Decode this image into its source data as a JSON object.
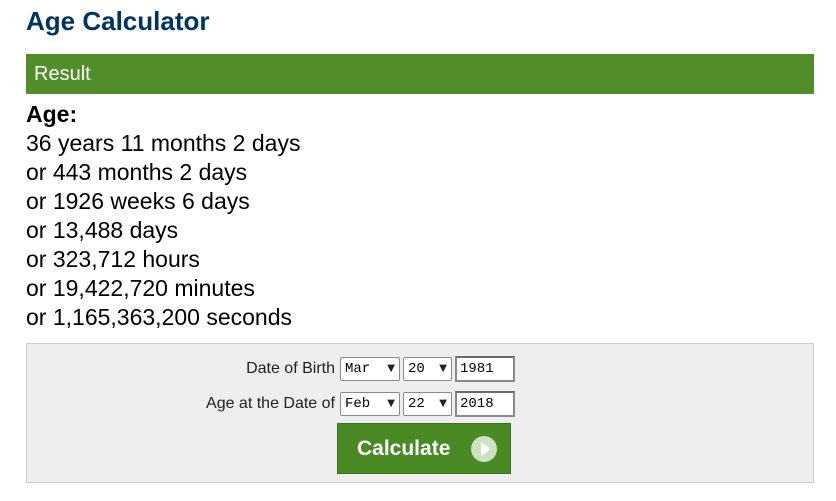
{
  "page": {
    "title": "Age Calculator"
  },
  "result": {
    "header": "Result",
    "age_label": "Age:",
    "lines": [
      "36 years 11 months 2 days",
      "or 443 months 2 days",
      "or 1926 weeks 6 days",
      "or 13,488 days",
      "or 323,712 hours",
      "or 19,422,720 minutes",
      "or 1,165,363,200 seconds"
    ]
  },
  "form": {
    "dob": {
      "label": "Date of Birth",
      "month": "Mar",
      "day": "20",
      "year": "1981"
    },
    "age_at": {
      "label": "Age at the Date of",
      "month": "Feb",
      "day": "22",
      "year": "2018"
    },
    "calculate_label": "Calculate"
  },
  "colors": {
    "title": "#003366",
    "result_bar": "#518e2a",
    "button": "#4a8a24"
  },
  "icons": {
    "select_arrow": "▼",
    "button_icon": "play-circle-icon"
  }
}
